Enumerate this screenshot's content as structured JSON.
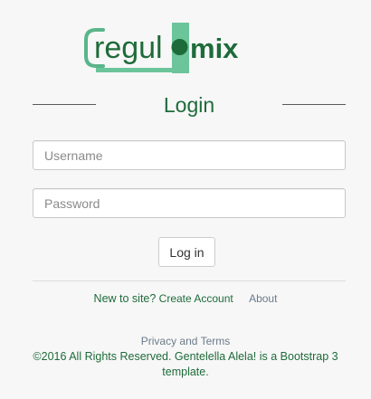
{
  "logo": {
    "text_left": "regul",
    "text_right": "mix",
    "colors": {
      "primary": "#1e6b3a",
      "accent": "#6cc49a",
      "bracket": "#5ab58a"
    }
  },
  "login": {
    "title": "Login",
    "username_placeholder": "Username",
    "password_placeholder": "Password",
    "submit_label": "Log in"
  },
  "signup": {
    "prompt": "New to site?",
    "create_account_label": "Create Account",
    "about_label": "About"
  },
  "footer": {
    "privacy_label": "Privacy and Terms",
    "copyright": "©2016 All Rights Reserved. Gentelella Alela! is a Bootstrap 3 template."
  },
  "colors": {
    "background": "#f7f7f7",
    "primary_green": "#1e6b3a",
    "muted_link": "#6b7b8a"
  }
}
